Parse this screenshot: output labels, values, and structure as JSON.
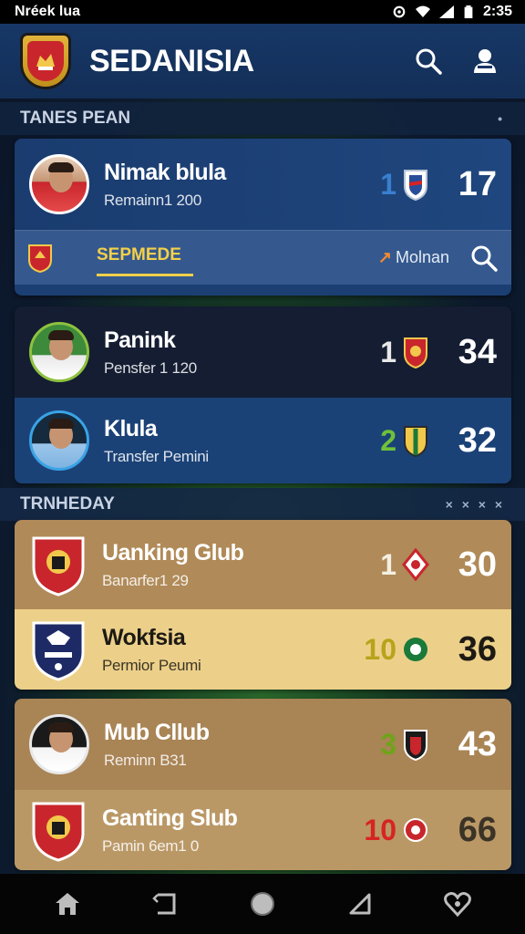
{
  "status_bar": {
    "carrier": "Nréek lua",
    "time": "2:35",
    "icons": [
      "sync-icon",
      "wifi-icon",
      "signal-icon",
      "battery-icon"
    ]
  },
  "header": {
    "title": "SEDANISIA",
    "logo": "club-crest-logo",
    "search_icon": "search-icon",
    "profile_icon": "user-icon"
  },
  "section_top": {
    "label": "TANES PEAN",
    "indicator": "•"
  },
  "card_blue": {
    "player": {
      "name": "Nimak blula",
      "sub": "Remainn1 200",
      "rank": "1",
      "score": "17"
    },
    "subbar": {
      "tab_label": "SEPMEDE",
      "filter_label": "Molnan"
    }
  },
  "card_dark": {
    "rows": [
      {
        "name": "Panink",
        "sub": "Pensfer 1 120",
        "rank": "1",
        "score": "34"
      },
      {
        "name": "Klula",
        "sub": "Transfer Pemini",
        "rank": "2",
        "score": "32"
      }
    ]
  },
  "section_mid": {
    "label": "TRNHEDAY",
    "side": "× × × ×"
  },
  "card_tan_1": {
    "rows": [
      {
        "name": "Uanking Glub",
        "sub": "Banarfer1 29",
        "rank": "1",
        "score": "30"
      },
      {
        "name": "Wokfsia",
        "sub": "Permior Peumi",
        "rank": "10",
        "score": "36"
      }
    ]
  },
  "card_tan_2": {
    "rows": [
      {
        "name": "Mub Cllub",
        "sub": "Reminn B31",
        "rank": "3",
        "score": "43"
      },
      {
        "name": "Ganting Slub",
        "sub": "Pamin 6em1 0",
        "rank": "10",
        "score": "66"
      }
    ]
  },
  "colors": {
    "accent_yellow": "#f4d04a",
    "rank_blue": "#3a7fd0",
    "rank_green": "#6fc13a",
    "rank_olive": "#b8a31a",
    "rank_red": "#d62424",
    "header_bg": "#173766"
  },
  "nav": {
    "items": [
      "home-icon",
      "back-icon",
      "circle-home-icon",
      "recent-apps-icon",
      "favorites-icon"
    ]
  }
}
